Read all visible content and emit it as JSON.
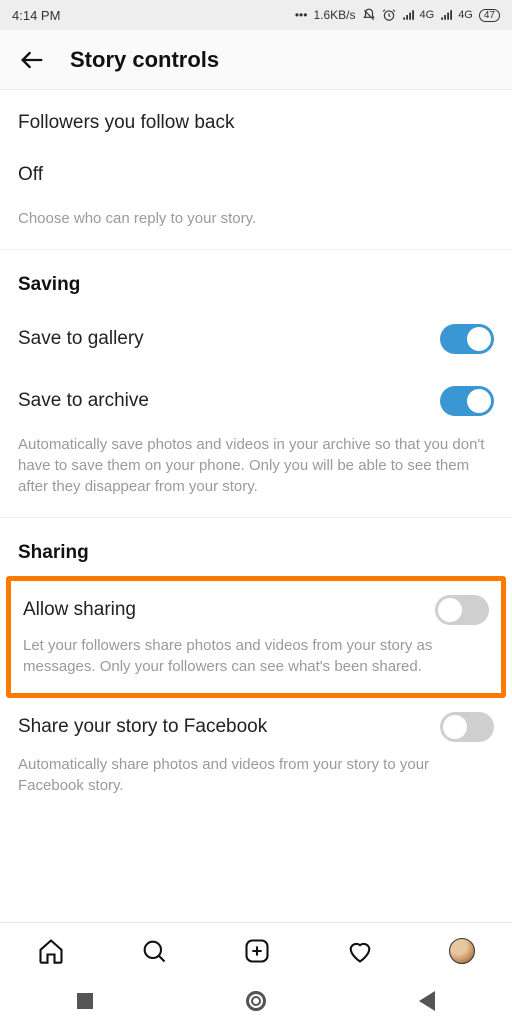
{
  "status": {
    "time": "4:14 PM",
    "speed": "1.6KB/s",
    "net1": "4G",
    "net2": "4G",
    "battery": "47"
  },
  "header": {
    "title": "Story controls"
  },
  "replies": {
    "option1": "Followers you follow back",
    "option2": "Off",
    "desc": "Choose who can reply to your story."
  },
  "saving": {
    "title": "Saving",
    "gallery": "Save to gallery",
    "archive": "Save to archive",
    "desc": "Automatically save photos and videos in your archive so that you don't have to save them on your phone. Only you will be able to see them after they disappear from your story."
  },
  "sharing": {
    "title": "Sharing",
    "allow": "Allow sharing",
    "allow_desc": "Let your followers share photos and videos from your story as messages. Only your followers can see what's been shared.",
    "fb": "Share your story to Facebook",
    "fb_desc": "Automatically share photos and videos from your story to your Facebook story."
  }
}
